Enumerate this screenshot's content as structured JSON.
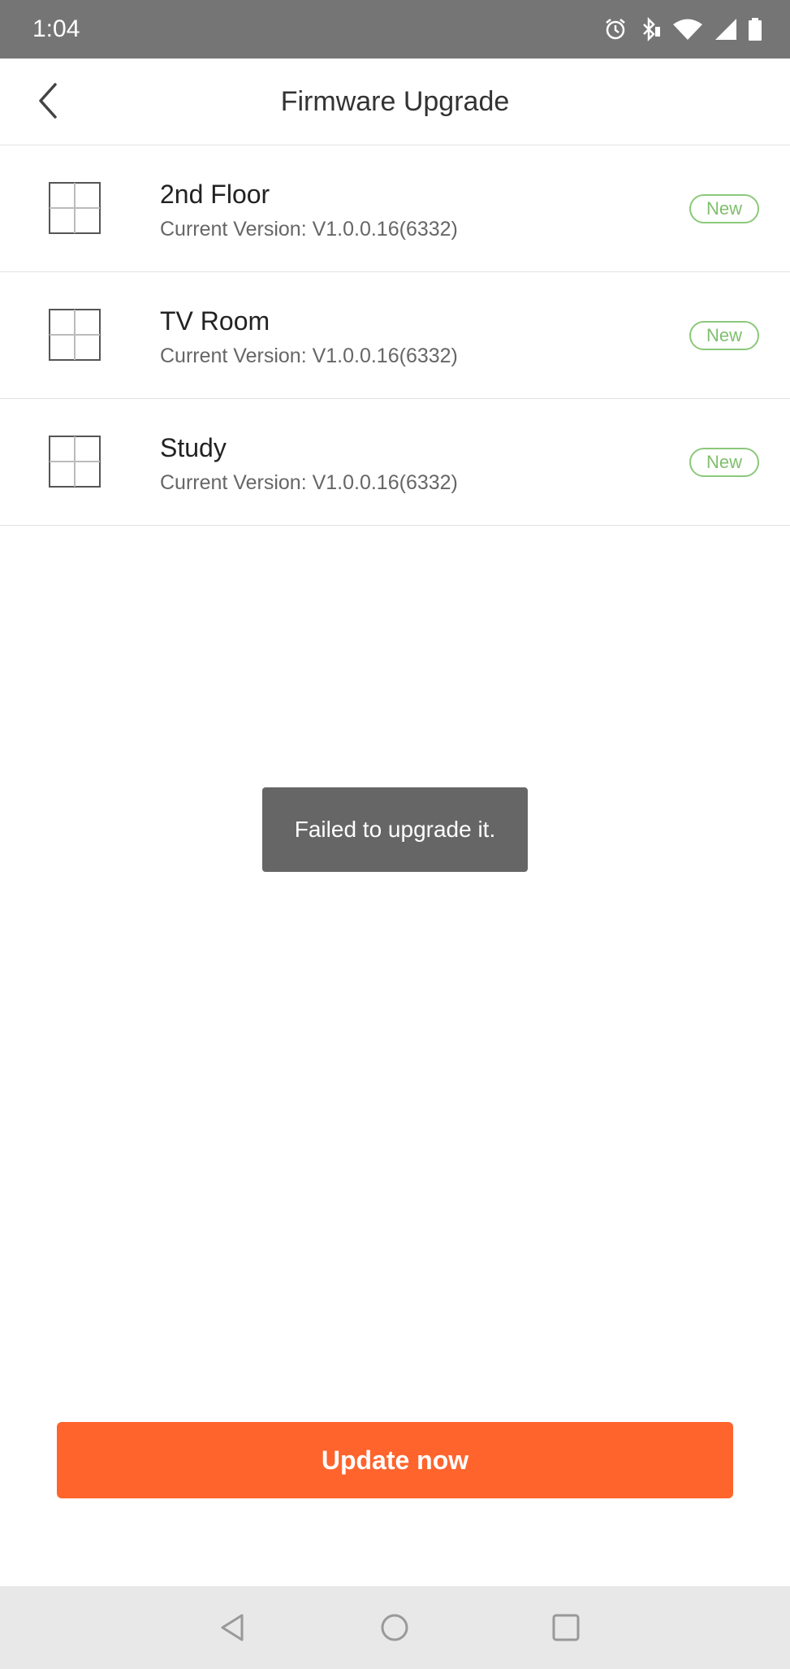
{
  "status_bar": {
    "time": "1:04",
    "icons": [
      "alarm-icon",
      "bluetooth-icon",
      "wifi-icon",
      "signal-icon",
      "battery-icon"
    ]
  },
  "header": {
    "title": "Firmware Upgrade",
    "back_icon": "chevron-left-icon"
  },
  "devices": [
    {
      "name": "2nd Floor",
      "version": "Current Version: V1.0.0.16(6332)",
      "badge": "New",
      "icon": "window-grid-icon"
    },
    {
      "name": "TV Room",
      "version": "Current Version: V1.0.0.16(6332)",
      "badge": "New",
      "icon": "window-grid-icon"
    },
    {
      "name": "Study",
      "version": "Current Version: V1.0.0.16(6332)",
      "badge": "New",
      "icon": "window-grid-icon"
    }
  ],
  "toast": {
    "message": "Failed to upgrade it."
  },
  "update_button": {
    "label": "Update now"
  },
  "nav_bar": {
    "icons": [
      "nav-back-icon",
      "nav-home-icon",
      "nav-recents-icon"
    ]
  },
  "colors": {
    "status_bar": "#757575",
    "accent": "#ff642d",
    "badge_green": "#7fbf6c",
    "toast": "#666666",
    "nav_bar": "#e8e8e8"
  }
}
